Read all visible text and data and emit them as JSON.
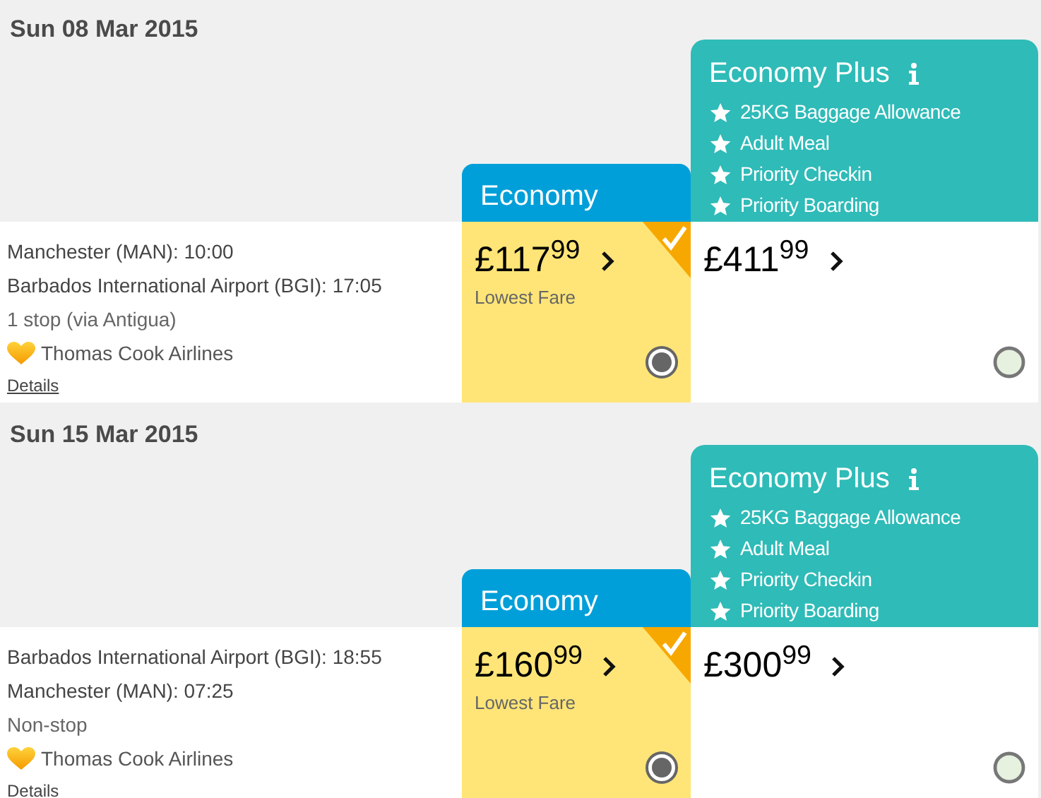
{
  "flights": [
    {
      "date": "Sun 08 Mar 2015",
      "legs": [
        "Manchester (MAN): 10:00",
        "Barbados International Airport (BGI): 17:05"
      ],
      "stops": "1 stop (via Antigua)",
      "airline": "Thomas Cook Airlines",
      "details_link": "Details",
      "fares": [
        {
          "kind": "economy",
          "title": "Economy",
          "price": "£117$^{99}$",
          "note": "Lowest Fare",
          "selected": true
        },
        {
          "kind": "plus",
          "title": "Economy Plus",
          "features": [
            "25KG Baggage Allowance",
            "Adult Meal",
            "Priority Checkin",
            "Priority Boarding"
          ],
          "price": "£411$^{99}$",
          "selected": false
        }
      ]
    },
    {
      "date": "Sun 15 Mar 2015",
      "legs": [
        "Barbados International Airport (BGI): 18:55",
        "Manchester (MAN): 07:25"
      ],
      "stops": "Non-stop",
      "airline": "Thomas Cook Airlines",
      "details_link": "Details",
      "fares": [
        {
          "kind": "economy",
          "title": "Economy",
          "price": "£160$^{99}$",
          "note": "Lowest Fare",
          "selected": true
        },
        {
          "kind": "plus",
          "title": "Economy Plus",
          "features": [
            "25KG Baggage Allowance",
            "Adult Meal",
            "Priority Checkin",
            "Priority Boarding"
          ],
          "price": "£300$^{99}$",
          "selected": false
        }
      ]
    }
  ]
}
